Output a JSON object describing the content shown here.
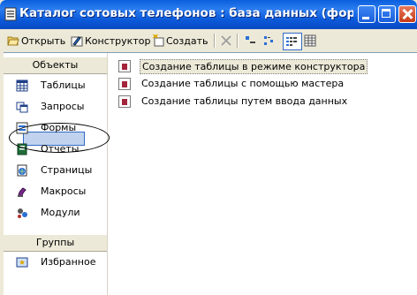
{
  "window": {
    "title": "Каталог сотовых телефонов : база данных (формат Acce..."
  },
  "toolbar": {
    "open_label": "Открыть",
    "design_label": "Конструктор",
    "create_label": "Создать"
  },
  "nav": {
    "objects_header": "Объекты",
    "items": [
      {
        "label": "Таблицы",
        "icon": "table-icon"
      },
      {
        "label": "Запросы",
        "icon": "query-icon"
      },
      {
        "label": "Формы",
        "icon": "form-icon"
      },
      {
        "label": "Отчеты",
        "icon": "report-icon"
      },
      {
        "label": "Страницы",
        "icon": "page-icon"
      },
      {
        "label": "Макросы",
        "icon": "macro-icon"
      },
      {
        "label": "Модули",
        "icon": "module-icon"
      }
    ],
    "groups_header": "Группы",
    "favorites_label": "Избранное"
  },
  "list": {
    "items": [
      "Создание таблицы в режиме конструктора",
      "Создание таблицы с помощью мастера",
      "Создание таблицы путем ввода данных"
    ]
  },
  "colors": {
    "titlebar": "#0a5fdc",
    "window_bg": "#ece9d8",
    "selection": "#c1d2ee"
  }
}
